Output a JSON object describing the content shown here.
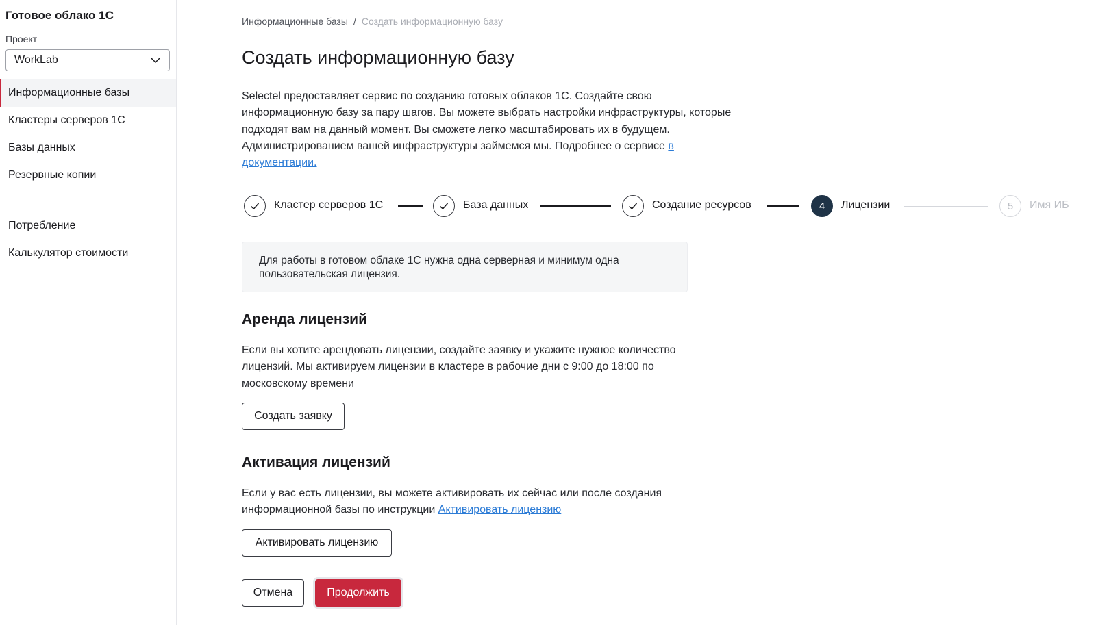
{
  "sidebar": {
    "app_title": "Готовое облако 1С",
    "project_label": "Проект",
    "project_value": "WorkLab",
    "items": [
      {
        "label": "Информационные базы"
      },
      {
        "label": "Кластеры серверов 1С"
      },
      {
        "label": "Базы данных"
      },
      {
        "label": "Резервные копии"
      }
    ],
    "items2": [
      {
        "label": "Потребление"
      },
      {
        "label": "Калькулятор стоимости"
      }
    ]
  },
  "breadcrumb": {
    "parent": "Информационные базы",
    "separator": "/",
    "current": "Создать информационную базу"
  },
  "page_title": "Создать информационную базу",
  "intro": {
    "text": "Selectel предоставляет сервис по созданию готовых облаков 1С. Создайте свою информационную базу за пару шагов. Вы можете выбрать настройки инфраструктуры, которые подходят вам на данный момент. Вы сможете легко масштабировать их в будущем. Администрированием вашей инфраструктуры займемся мы. Подробнее о сервисе ",
    "link": "в документации."
  },
  "stepper": {
    "steps": [
      {
        "label": "Кластер серверов 1С",
        "state": "done"
      },
      {
        "label": "База данных",
        "state": "done"
      },
      {
        "label": "Создание ресурсов",
        "state": "done"
      },
      {
        "number": "4",
        "label": "Лицензии",
        "state": "current"
      },
      {
        "number": "5",
        "label": "Имя ИБ",
        "state": "future"
      }
    ]
  },
  "info_box": "Для работы в готовом облаке 1С нужна одна серверная и минимум одна пользовательская лицензия.",
  "rent": {
    "title": "Аренда лицензий",
    "text": "Если вы хотите арендовать лицензии, создайте заявку и укажите нужное количество лицензий. Мы активируем лицензии в кластере в рабочие дни с 9:00 до 18:00 по московскому времени",
    "button": "Создать заявку"
  },
  "activate": {
    "title": "Активация лицензий",
    "text": "Если у вас есть лицензии, вы можете активировать их сейчас или после создания информационной базы по инструкции ",
    "link": "Активировать лицензию",
    "button": "Активировать лицензию"
  },
  "footer": {
    "cancel": "Отмена",
    "continue": "Продолжить"
  },
  "colors": {
    "accent": "#c8283d",
    "link": "#2b7bd6",
    "step_current": "#1f3347"
  }
}
